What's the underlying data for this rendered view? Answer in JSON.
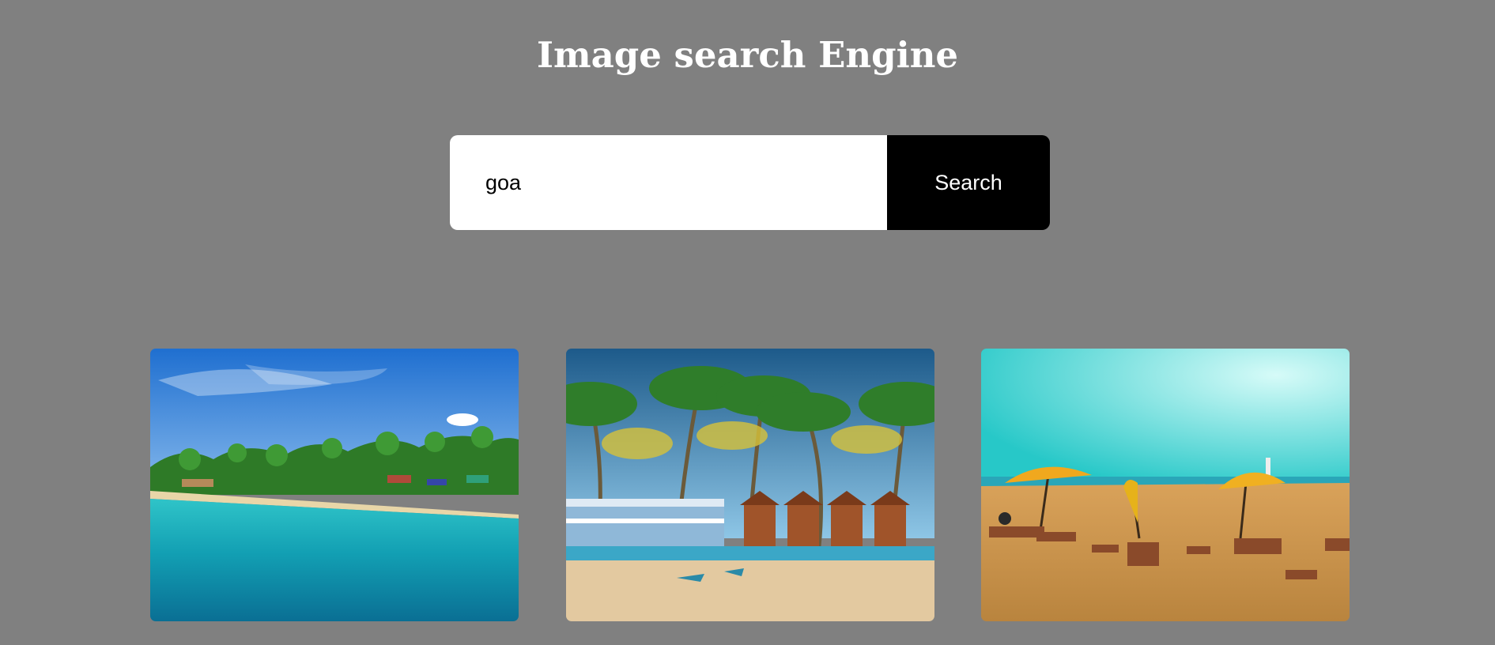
{
  "header": {
    "title": "Image search Engine"
  },
  "search": {
    "value": "goa",
    "button_label": "Search"
  },
  "results": [
    {
      "subject": "goa-beach-bay-with-turquoise-sea-and-palm-trees"
    },
    {
      "subject": "goa-beach-huts-under-coconut-palms"
    },
    {
      "subject": "goa-beach-with-yellow-umbrellas-and-loungers"
    }
  ],
  "colors": {
    "background": "#808080",
    "title_text": "#ffffff",
    "input_background": "#ffffff",
    "button_background": "#000000",
    "button_text": "#ffffff"
  }
}
